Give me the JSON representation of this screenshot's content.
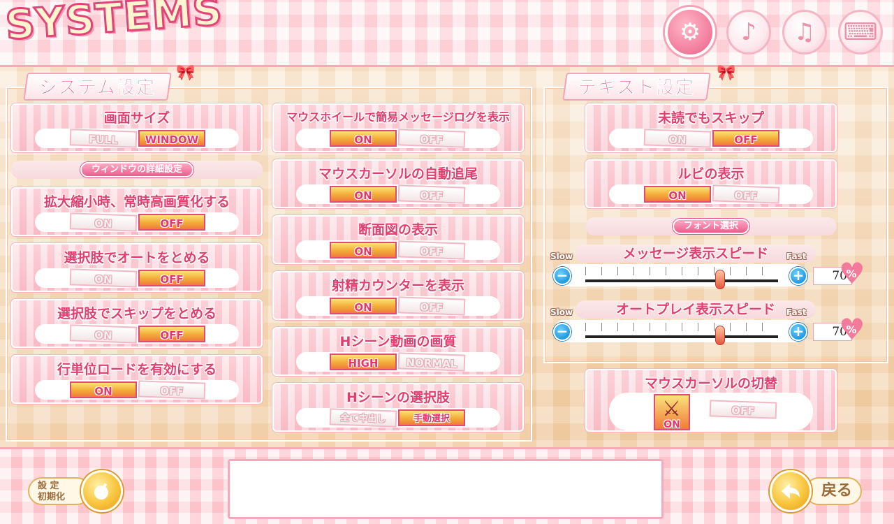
{
  "header": {
    "title": "SYSTEMS",
    "tabs": [
      {
        "icon": "gear-icon",
        "glyph": "⚙",
        "active": true
      },
      {
        "icon": "music-note-icon",
        "glyph": "♪",
        "active": false
      },
      {
        "icon": "music-notes-icon",
        "glyph": "♫",
        "active": false
      },
      {
        "icon": "keyboard-icon",
        "glyph": "⌨",
        "active": false
      }
    ]
  },
  "system": {
    "label": "システム設定",
    "screen_size": {
      "title": "画面サイズ",
      "opt1": "FULL",
      "opt2": "WINDOW",
      "selected": "WINDOW"
    },
    "window_detail": "ウィンドウの詳細設定",
    "hq_scale": {
      "title": "拡大縮小時、常時高画質化する",
      "opt1": "ON",
      "opt2": "OFF",
      "selected": "OFF"
    },
    "stop_auto_on_choice": {
      "title": "選択肢でオートをとめる",
      "opt1": "ON",
      "opt2": "OFF",
      "selected": "OFF"
    },
    "stop_skip_on_choice": {
      "title": "選択肢でスキップをとめる",
      "opt1": "ON",
      "opt2": "OFF",
      "selected": "OFF"
    },
    "line_load": {
      "title": "行単位ロードを有効にする",
      "opt1": "ON",
      "opt2": "OFF",
      "selected": "ON"
    },
    "wheel_log": {
      "title": "マウスホイールで簡易メッセージログを表示",
      "opt1": "ON",
      "opt2": "OFF",
      "selected": "ON"
    },
    "cursor_follow": {
      "title": "マウスカーソルの自動追尾",
      "opt1": "ON",
      "opt2": "OFF",
      "selected": "ON"
    },
    "cross_section": {
      "title": "断面図の表示",
      "opt1": "ON",
      "opt2": "OFF",
      "selected": "ON"
    },
    "counter": {
      "title": "射精カウンターを表示",
      "opt1": "ON",
      "opt2": "OFF",
      "selected": "ON"
    },
    "video_quality": {
      "title": "Hシーン動画の画質",
      "opt1": "HIGH",
      "opt2": "NORMAL",
      "selected": "HIGH"
    },
    "h_choice": {
      "title": "Hシーンの選択肢",
      "opt1": "全て中出し",
      "opt2": "手動選択",
      "selected": "手動選択"
    }
  },
  "text": {
    "label": "テキスト設定",
    "skip_unread": {
      "title": "未読でもスキップ",
      "opt1": "ON",
      "opt2": "OFF",
      "selected": "OFF"
    },
    "ruby": {
      "title": "ルビの表示",
      "opt1": "ON",
      "opt2": "OFF",
      "selected": "ON"
    },
    "font_select": "フォント選択",
    "msg_speed": {
      "title": "メッセージ表示スピード",
      "slow": "Slow",
      "fast": "Fast",
      "value": "70",
      "percent": 70,
      "unit": "%"
    },
    "auto_speed": {
      "title": "オートプレイ表示スピード",
      "slow": "Slow",
      "fast": "Fast",
      "value": "70",
      "percent": 70,
      "unit": "%"
    }
  },
  "cursor_switch": {
    "title": "マウスカーソルの切替",
    "on": "ON",
    "off": "OFF",
    "selected": "ON"
  },
  "footer": {
    "reset_label": "設 定\n初期化",
    "back_label": "戻る"
  },
  "colors": {
    "accent": "#e23e6f",
    "selected": "#f5b53d",
    "blue": "#1f9be0"
  }
}
